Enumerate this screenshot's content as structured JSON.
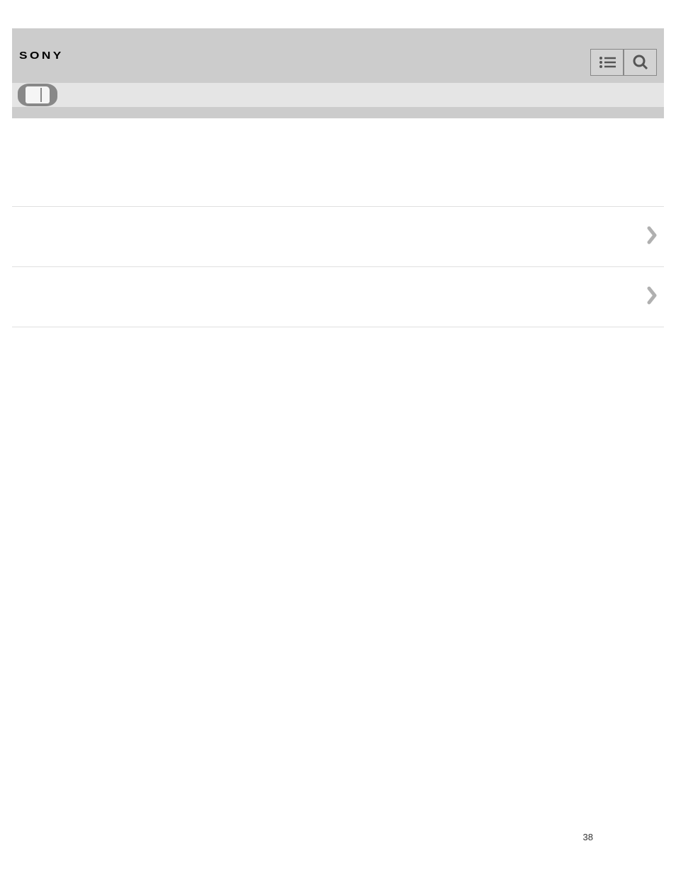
{
  "header": {
    "brand": "SONY"
  },
  "list": {
    "items": [
      {
        "label": ""
      },
      {
        "label": ""
      }
    ]
  },
  "page_number": "38"
}
